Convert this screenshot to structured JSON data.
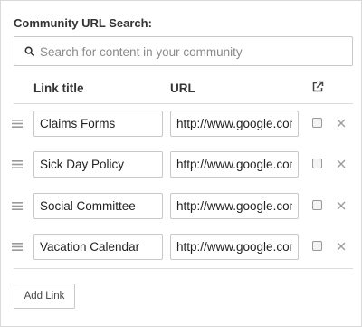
{
  "title": "Community URL Search:",
  "search": {
    "placeholder": "Search for content in your community",
    "value": ""
  },
  "columns": {
    "link_title": "Link title",
    "url": "URL",
    "open_icon": "external-link-icon"
  },
  "rows": [
    {
      "title": "Claims Forms",
      "url": "http://www.google.com",
      "checked": false
    },
    {
      "title": "Sick Day Policy",
      "url": "http://www.google.com",
      "checked": false
    },
    {
      "title": "Social Committee",
      "url": "http://www.google.com",
      "checked": false
    },
    {
      "title": "Vacation Calendar",
      "url": "http://www.google.com",
      "checked": false
    }
  ],
  "add_button": "Add Link",
  "colors": {
    "border": "#c8c8c8",
    "text": "#333333",
    "icon": "#9a9a9a"
  }
}
